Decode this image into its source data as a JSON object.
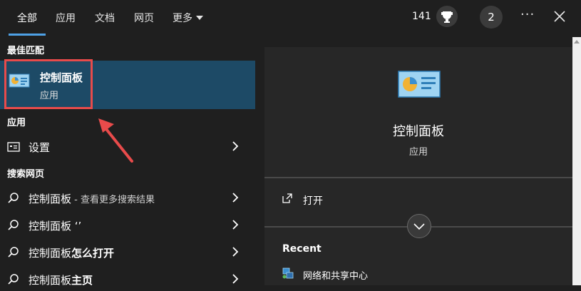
{
  "tabs": [
    {
      "label": "全部"
    },
    {
      "label": "应用"
    },
    {
      "label": "文档"
    },
    {
      "label": "网页"
    },
    {
      "label": "更多"
    }
  ],
  "header": {
    "points": "141",
    "badge_count": "2",
    "more_label": "···"
  },
  "left": {
    "best_match_header": "最佳匹配",
    "best_match": {
      "title": "控制面板",
      "subtitle": "应用",
      "icon": "control-panel-icon"
    },
    "apps_header": "应用",
    "apps": [
      {
        "label": "设置",
        "icon": "settings-icon"
      }
    ],
    "web_header": "搜索网页",
    "web_results": [
      {
        "term": "控制面板",
        "suffix": " - 查看更多搜索结果"
      },
      {
        "term": "控制面板 ‘’",
        "suffix": ""
      },
      {
        "term": "控制面板",
        "suffix": "怎么打开"
      },
      {
        "term": "控制面板",
        "suffix": "主页"
      }
    ]
  },
  "right": {
    "title": "控制面板",
    "subtitle": "应用",
    "open_label": "打开",
    "recent_header": "Recent",
    "recent_items": [
      {
        "label": "网络和共享中心",
        "icon": "network-icon"
      }
    ]
  },
  "colors": {
    "selected_bg": "#1d4a66",
    "highlight_box": "#e84b4b",
    "tab_underline": "#4ea1e6"
  }
}
